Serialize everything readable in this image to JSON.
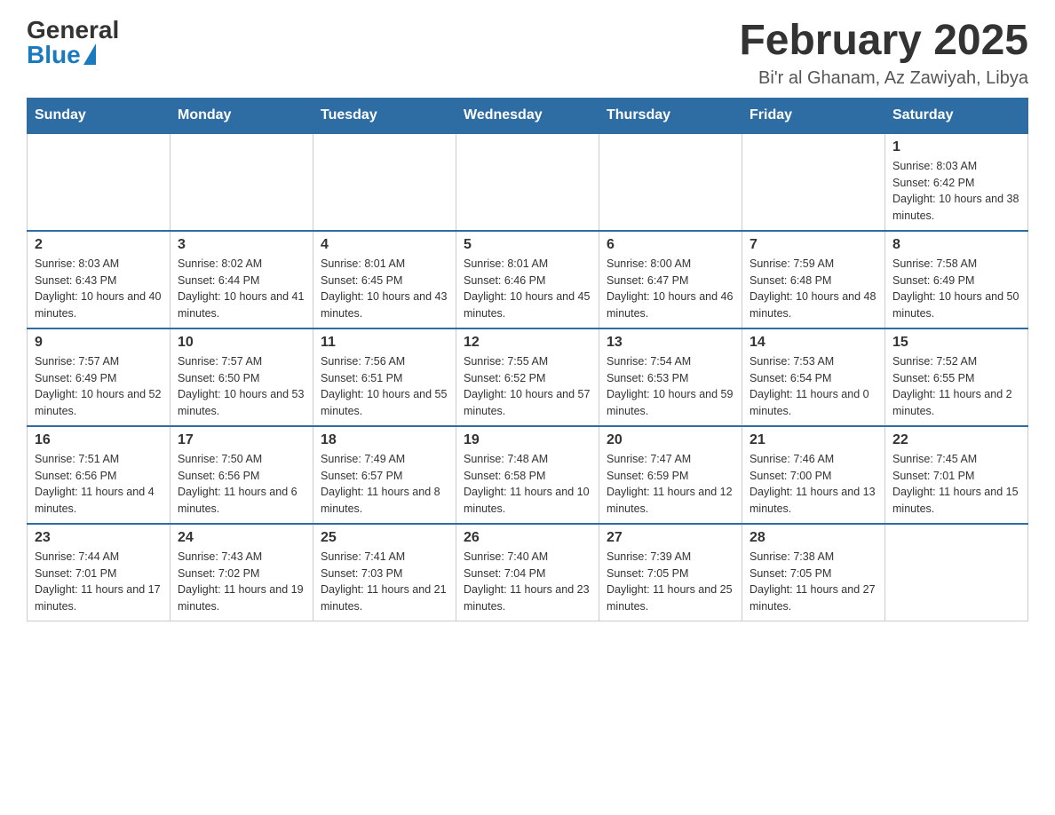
{
  "header": {
    "logo_general": "General",
    "logo_blue": "Blue",
    "title": "February 2025",
    "subtitle": "Bi'r al Ghanam, Az Zawiyah, Libya"
  },
  "days_of_week": [
    "Sunday",
    "Monday",
    "Tuesday",
    "Wednesday",
    "Thursday",
    "Friday",
    "Saturday"
  ],
  "weeks": [
    {
      "days": [
        {
          "number": "",
          "info": ""
        },
        {
          "number": "",
          "info": ""
        },
        {
          "number": "",
          "info": ""
        },
        {
          "number": "",
          "info": ""
        },
        {
          "number": "",
          "info": ""
        },
        {
          "number": "",
          "info": ""
        },
        {
          "number": "1",
          "info": "Sunrise: 8:03 AM\nSunset: 6:42 PM\nDaylight: 10 hours and 38 minutes."
        }
      ]
    },
    {
      "days": [
        {
          "number": "2",
          "info": "Sunrise: 8:03 AM\nSunset: 6:43 PM\nDaylight: 10 hours and 40 minutes."
        },
        {
          "number": "3",
          "info": "Sunrise: 8:02 AM\nSunset: 6:44 PM\nDaylight: 10 hours and 41 minutes."
        },
        {
          "number": "4",
          "info": "Sunrise: 8:01 AM\nSunset: 6:45 PM\nDaylight: 10 hours and 43 minutes."
        },
        {
          "number": "5",
          "info": "Sunrise: 8:01 AM\nSunset: 6:46 PM\nDaylight: 10 hours and 45 minutes."
        },
        {
          "number": "6",
          "info": "Sunrise: 8:00 AM\nSunset: 6:47 PM\nDaylight: 10 hours and 46 minutes."
        },
        {
          "number": "7",
          "info": "Sunrise: 7:59 AM\nSunset: 6:48 PM\nDaylight: 10 hours and 48 minutes."
        },
        {
          "number": "8",
          "info": "Sunrise: 7:58 AM\nSunset: 6:49 PM\nDaylight: 10 hours and 50 minutes."
        }
      ]
    },
    {
      "days": [
        {
          "number": "9",
          "info": "Sunrise: 7:57 AM\nSunset: 6:49 PM\nDaylight: 10 hours and 52 minutes."
        },
        {
          "number": "10",
          "info": "Sunrise: 7:57 AM\nSunset: 6:50 PM\nDaylight: 10 hours and 53 minutes."
        },
        {
          "number": "11",
          "info": "Sunrise: 7:56 AM\nSunset: 6:51 PM\nDaylight: 10 hours and 55 minutes."
        },
        {
          "number": "12",
          "info": "Sunrise: 7:55 AM\nSunset: 6:52 PM\nDaylight: 10 hours and 57 minutes."
        },
        {
          "number": "13",
          "info": "Sunrise: 7:54 AM\nSunset: 6:53 PM\nDaylight: 10 hours and 59 minutes."
        },
        {
          "number": "14",
          "info": "Sunrise: 7:53 AM\nSunset: 6:54 PM\nDaylight: 11 hours and 0 minutes."
        },
        {
          "number": "15",
          "info": "Sunrise: 7:52 AM\nSunset: 6:55 PM\nDaylight: 11 hours and 2 minutes."
        }
      ]
    },
    {
      "days": [
        {
          "number": "16",
          "info": "Sunrise: 7:51 AM\nSunset: 6:56 PM\nDaylight: 11 hours and 4 minutes."
        },
        {
          "number": "17",
          "info": "Sunrise: 7:50 AM\nSunset: 6:56 PM\nDaylight: 11 hours and 6 minutes."
        },
        {
          "number": "18",
          "info": "Sunrise: 7:49 AM\nSunset: 6:57 PM\nDaylight: 11 hours and 8 minutes."
        },
        {
          "number": "19",
          "info": "Sunrise: 7:48 AM\nSunset: 6:58 PM\nDaylight: 11 hours and 10 minutes."
        },
        {
          "number": "20",
          "info": "Sunrise: 7:47 AM\nSunset: 6:59 PM\nDaylight: 11 hours and 12 minutes."
        },
        {
          "number": "21",
          "info": "Sunrise: 7:46 AM\nSunset: 7:00 PM\nDaylight: 11 hours and 13 minutes."
        },
        {
          "number": "22",
          "info": "Sunrise: 7:45 AM\nSunset: 7:01 PM\nDaylight: 11 hours and 15 minutes."
        }
      ]
    },
    {
      "days": [
        {
          "number": "23",
          "info": "Sunrise: 7:44 AM\nSunset: 7:01 PM\nDaylight: 11 hours and 17 minutes."
        },
        {
          "number": "24",
          "info": "Sunrise: 7:43 AM\nSunset: 7:02 PM\nDaylight: 11 hours and 19 minutes."
        },
        {
          "number": "25",
          "info": "Sunrise: 7:41 AM\nSunset: 7:03 PM\nDaylight: 11 hours and 21 minutes."
        },
        {
          "number": "26",
          "info": "Sunrise: 7:40 AM\nSunset: 7:04 PM\nDaylight: 11 hours and 23 minutes."
        },
        {
          "number": "27",
          "info": "Sunrise: 7:39 AM\nSunset: 7:05 PM\nDaylight: 11 hours and 25 minutes."
        },
        {
          "number": "28",
          "info": "Sunrise: 7:38 AM\nSunset: 7:05 PM\nDaylight: 11 hours and 27 minutes."
        },
        {
          "number": "",
          "info": ""
        }
      ]
    }
  ]
}
